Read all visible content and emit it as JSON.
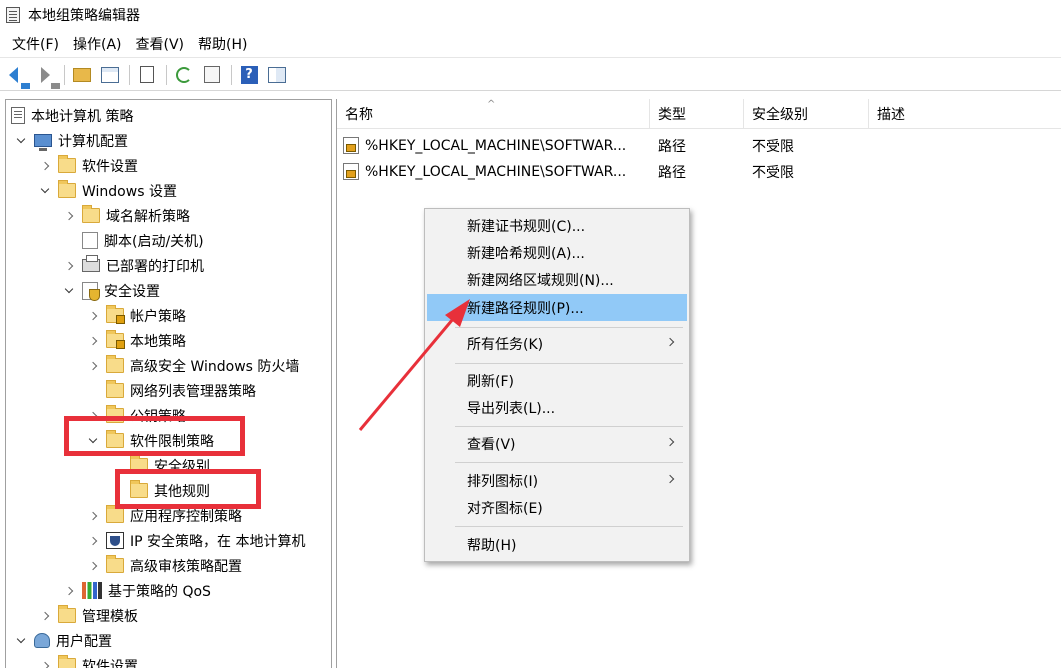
{
  "window": {
    "title": "本地组策略编辑器"
  },
  "menubar": {
    "items": [
      "文件(F)",
      "操作(A)",
      "查看(V)",
      "帮助(H)"
    ]
  },
  "toolbar": {
    "buttons": [
      "back-arrow-icon",
      "forward-arrow-icon",
      "up-folder-icon",
      "show-hide-tree-icon",
      "properties-icon",
      "refresh-icon",
      "export-list-icon",
      "help-icon",
      "action-pane-icon"
    ]
  },
  "tree": {
    "items": [
      {
        "label": "本地计算机 策略",
        "expander": "none",
        "icon": "policy-icon"
      },
      {
        "label": "计算机配置",
        "expander": "down",
        "icon": "computer-icon"
      },
      {
        "label": "软件设置",
        "expander": "right",
        "icon": "folder-icon"
      },
      {
        "label": "Windows 设置",
        "expander": "down",
        "icon": "folder-icon"
      },
      {
        "label": "域名解析策略",
        "expander": "right",
        "icon": "folder-icon"
      },
      {
        "label": "脚本(启动/关机)",
        "expander": "none",
        "icon": "script-icon"
      },
      {
        "label": "已部署的打印机",
        "expander": "right",
        "icon": "printer-icon"
      },
      {
        "label": "安全设置",
        "expander": "down",
        "icon": "security-icon"
      },
      {
        "label": "帐户策略",
        "expander": "right",
        "icon": "lock-folder-icon"
      },
      {
        "label": "本地策略",
        "expander": "right",
        "icon": "lock-folder-icon"
      },
      {
        "label": "高级安全 Windows 防火墙",
        "expander": "right",
        "icon": "folder-icon"
      },
      {
        "label": "网络列表管理器策略",
        "expander": "none",
        "icon": "folder-icon"
      },
      {
        "label": "公钥策略",
        "expander": "right",
        "icon": "folder-icon"
      },
      {
        "label": "软件限制策略",
        "expander": "down",
        "icon": "folder-icon"
      },
      {
        "label": "安全级别",
        "expander": "none",
        "icon": "folder-icon"
      },
      {
        "label": "其他规则",
        "expander": "none",
        "icon": "folder-icon"
      },
      {
        "label": "应用程序控制策略",
        "expander": "right",
        "icon": "folder-icon"
      },
      {
        "label": "IP 安全策略，在 本地计算机",
        "expander": "right",
        "icon": "ip-security-icon"
      },
      {
        "label": "高级审核策略配置",
        "expander": "right",
        "icon": "folder-icon"
      },
      {
        "label": "基于策略的 QoS",
        "expander": "right",
        "icon": "qos-chart-icon"
      },
      {
        "label": "管理模板",
        "expander": "right",
        "icon": "folder-icon"
      },
      {
        "label": "用户配置",
        "expander": "down",
        "icon": "users-icon"
      },
      {
        "label": "软件设置",
        "expander": "right",
        "icon": "folder-icon"
      }
    ]
  },
  "list": {
    "columns": [
      "名称",
      "类型",
      "安全级别",
      "描述"
    ],
    "rows": [
      {
        "name": "%HKEY_LOCAL_MACHINE\\SOFTWAR...",
        "type": "路径",
        "level": "不受限",
        "desc": ""
      },
      {
        "name": "%HKEY_LOCAL_MACHINE\\SOFTWAR...",
        "type": "路径",
        "level": "不受限",
        "desc": ""
      }
    ]
  },
  "context_menu": {
    "items": [
      {
        "label": "新建证书规则(C)...",
        "submenu": false
      },
      {
        "label": "新建哈希规则(A)...",
        "submenu": false
      },
      {
        "label": "新建网络区域规则(N)...",
        "submenu": false
      },
      {
        "label": "新建路径规则(P)...",
        "submenu": false,
        "highlighted": true
      },
      {
        "label": "所有任务(K)",
        "submenu": true
      },
      {
        "label": "刷新(F)",
        "submenu": false
      },
      {
        "label": "导出列表(L)...",
        "submenu": false
      },
      {
        "label": "查看(V)",
        "submenu": true
      },
      {
        "label": "排列图标(I)",
        "submenu": true
      },
      {
        "label": "对齐图标(E)",
        "submenu": false
      },
      {
        "label": "帮助(H)",
        "submenu": false
      }
    ]
  },
  "annotation": {
    "color": "#e8303a"
  },
  "colors": {
    "highlight": "#91c9f7",
    "annotation_red": "#e8303a"
  }
}
